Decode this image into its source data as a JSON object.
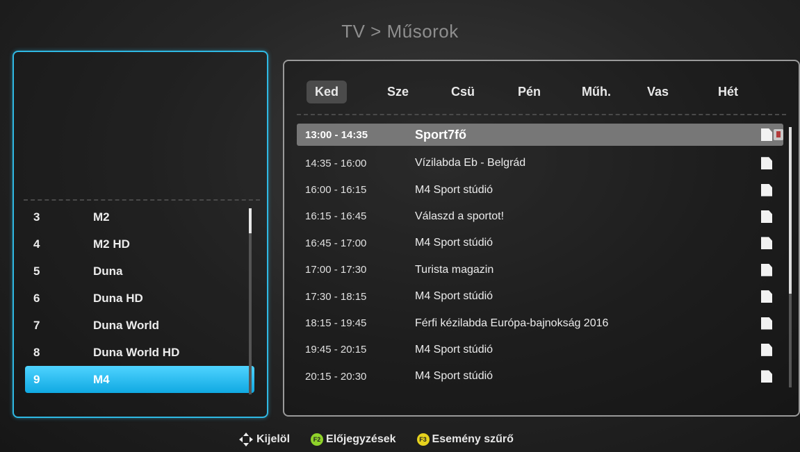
{
  "title": "TV > Műsorok",
  "days": [
    {
      "label": "Ked",
      "active": true
    },
    {
      "label": "Sze",
      "active": false
    },
    {
      "label": "Csü",
      "active": false
    },
    {
      "label": "Pén",
      "active": false
    },
    {
      "label": "Műh.",
      "active": false
    },
    {
      "label": "Vas",
      "active": false
    },
    {
      "label": "Hét",
      "active": false
    }
  ],
  "channels": [
    {
      "number": "3",
      "name": "M2"
    },
    {
      "number": "4",
      "name": "M2 HD"
    },
    {
      "number": "5",
      "name": "Duna"
    },
    {
      "number": "6",
      "name": "Duna HD"
    },
    {
      "number": "7",
      "name": "Duna World"
    },
    {
      "number": "8",
      "name": "Duna World HD"
    },
    {
      "number": "9",
      "name": "M4"
    }
  ],
  "selected_channel": "9",
  "programs": [
    {
      "time": "13:00 - 14:35",
      "title": "Sport7fő"
    },
    {
      "time": "14:35 - 16:00",
      "title": "Vízilabda Eb - Belgrád"
    },
    {
      "time": "16:00 - 16:15",
      "title": "M4 Sport stúdió"
    },
    {
      "time": "16:15 - 16:45",
      "title": "Válaszd a sportot!"
    },
    {
      "time": "16:45 - 17:00",
      "title": "M4 Sport stúdió"
    },
    {
      "time": "17:00 - 17:30",
      "title": "Turista magazin"
    },
    {
      "time": "17:30 - 18:15",
      "title": "M4 Sport stúdió"
    },
    {
      "time": "18:15 - 19:45",
      "title": "Férfi kézilabda Európa-bajnokság 2016"
    },
    {
      "time": "19:45 - 20:15",
      "title": "M4 Sport stúdió"
    },
    {
      "time": "20:15 - 20:30",
      "title": "M4 Sport stúdió"
    }
  ],
  "hints": {
    "select": "Kijelöl",
    "f2_label": "Előjegyzések",
    "f3_label": "Esemény szűrő",
    "f2_key": "F2",
    "f3_key": "F3"
  },
  "colors": {
    "accent": "#2fb9e4",
    "selection": "#10a9e2",
    "green_key": "#8fd22a",
    "yellow_key": "#e6d21d"
  },
  "icons": {
    "program_info": "document-icon",
    "reminder": "clock-reminder-icon",
    "navigate": "directional-arrows-icon"
  }
}
